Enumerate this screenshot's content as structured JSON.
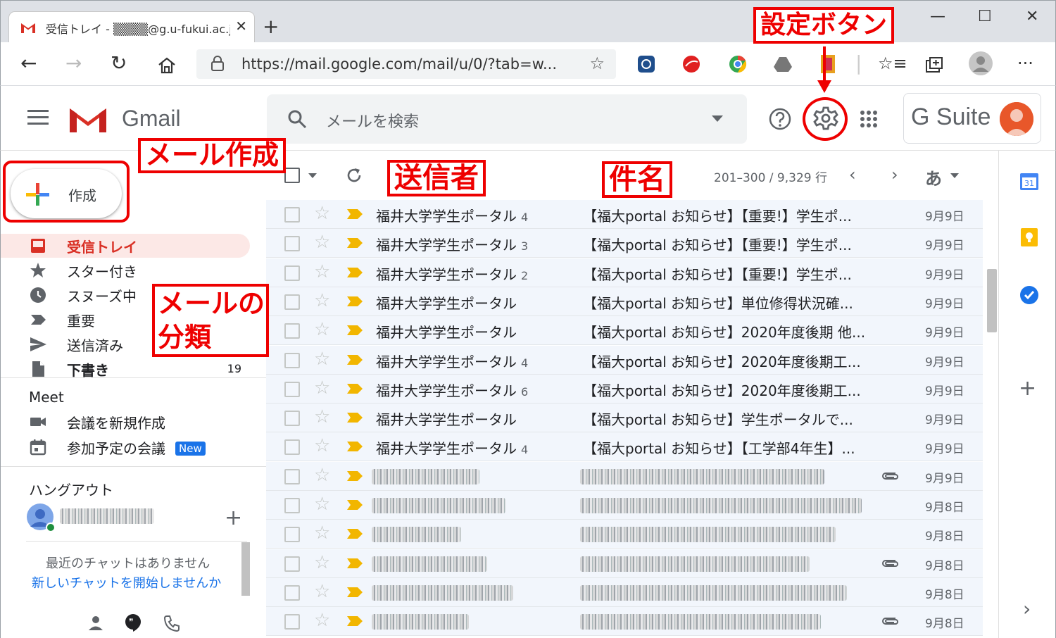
{
  "browser": {
    "tab_title": "受信トレイ - ▒▒▒▒@g.u-fukui.ac.jp",
    "url": "https://mail.google.com/mail/u/0/?tab=w..."
  },
  "gmail": {
    "logo_text": "Gmail",
    "search_placeholder": "メールを検索",
    "gsuite_label": "G Suite",
    "compose_label": "作成"
  },
  "sidebar": {
    "items": [
      {
        "label": "受信トレイ",
        "icon": "inbox-icon",
        "active": true,
        "count": ""
      },
      {
        "label": "スター付き",
        "icon": "star-icon",
        "active": false,
        "count": ""
      },
      {
        "label": "スヌーズ中",
        "icon": "clock-icon",
        "active": false,
        "count": ""
      },
      {
        "label": "重要",
        "icon": "important-icon",
        "active": false,
        "count": ""
      },
      {
        "label": "送信済み",
        "icon": "send-icon",
        "active": false,
        "count": ""
      },
      {
        "label": "下書き",
        "icon": "draft-icon",
        "active": false,
        "count": "19"
      }
    ],
    "meet": {
      "title": "Meet",
      "new_meeting": "会議を新規作成",
      "join_meeting": "参加予定の会議",
      "new_badge": "New"
    },
    "hangouts": {
      "title": "ハングアウト",
      "no_recent": "最近のチャットはありません",
      "start_chat": "新しいチャットを開始しませんか"
    }
  },
  "toolbar": {
    "range": "201–300 / 9,329 行",
    "ime": "あ"
  },
  "mails": [
    {
      "sender": "福井大学学生ポータル",
      "count": "4",
      "subject": "【福大portal お知らせ】【重要!】学生ポ...",
      "date": "9月9日",
      "blurred": false,
      "clip": false
    },
    {
      "sender": "福井大学学生ポータル",
      "count": "3",
      "subject": "【福大portal お知らせ】【重要!】学生ポ...",
      "date": "9月9日",
      "blurred": false,
      "clip": false
    },
    {
      "sender": "福井大学学生ポータル",
      "count": "2",
      "subject": "【福大portal お知らせ】【重要!】学生ポ...",
      "date": "9月9日",
      "blurred": false,
      "clip": false
    },
    {
      "sender": "福井大学学生ポータル",
      "count": "",
      "subject": "【福大portal お知らせ】単位修得状況確...",
      "date": "9月9日",
      "blurred": false,
      "clip": false
    },
    {
      "sender": "福井大学学生ポータル",
      "count": "",
      "subject": "【福大portal お知らせ】2020年度後期 他...",
      "date": "9月9日",
      "blurred": false,
      "clip": false
    },
    {
      "sender": "福井大学学生ポータル",
      "count": "4",
      "subject": "【福大portal お知らせ】2020年度後期工...",
      "date": "9月9日",
      "blurred": false,
      "clip": false
    },
    {
      "sender": "福井大学学生ポータル",
      "count": "6",
      "subject": "【福大portal お知らせ】2020年度後期工...",
      "date": "9月9日",
      "blurred": false,
      "clip": false
    },
    {
      "sender": "福井大学学生ポータル",
      "count": "",
      "subject": "【福大portal お知らせ】学生ポータルで...",
      "date": "9月9日",
      "blurred": false,
      "clip": false
    },
    {
      "sender": "福井大学学生ポータル",
      "count": "4",
      "subject": "【福大portal お知らせ】【工学部4年生】...",
      "date": "9月9日",
      "blurred": false,
      "clip": false
    },
    {
      "sender": "",
      "count": "",
      "subject": "",
      "date": "9月9日",
      "blurred": true,
      "clip": true
    },
    {
      "sender": "",
      "count": "",
      "subject": "",
      "date": "9月8日",
      "blurred": true,
      "clip": false
    },
    {
      "sender": "",
      "count": "",
      "subject": "",
      "date": "9月8日",
      "blurred": true,
      "clip": false
    },
    {
      "sender": "",
      "count": "",
      "subject": "",
      "date": "9月8日",
      "blurred": true,
      "clip": true
    },
    {
      "sender": "",
      "count": "",
      "subject": "",
      "date": "9月8日",
      "blurred": true,
      "clip": false
    },
    {
      "sender": "",
      "count": "",
      "subject": "",
      "date": "9月8日",
      "blurred": true,
      "clip": true
    }
  ],
  "annotations": {
    "settings": "設定ボタン",
    "compose": "メール作成",
    "sender": "送信者",
    "subject": "件名",
    "categories_line1": "メールの",
    "categories_line2": "分類"
  },
  "colors": {
    "annotation_red": "#ee0000",
    "gmail_red": "#d93025",
    "important_yellow": "#f2b600",
    "new_badge_blue": "#1a73e8"
  }
}
